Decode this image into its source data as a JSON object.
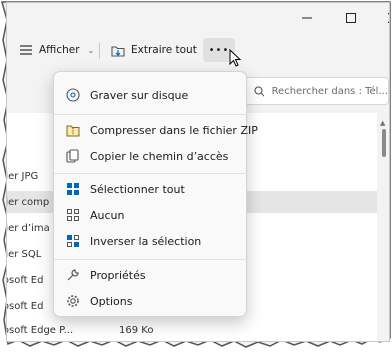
{
  "toolbar": {
    "view_label": "Afficher",
    "extract_label": "Extraire tout",
    "more_label": "•••"
  },
  "search": {
    "placeholder": "Rechercher dans : Tél..."
  },
  "menu": {
    "items": [
      {
        "label": "Graver sur disque",
        "icon": "disc-burn-icon"
      },
      {
        "label": "Compresser dans le fichier ZIP",
        "icon": "zip-folder-icon"
      },
      {
        "label": "Copier le chemin d’accès",
        "icon": "copy-path-icon"
      },
      {
        "label": "Sélectionner tout",
        "icon": "select-all-icon"
      },
      {
        "label": "Aucun",
        "icon": "select-none-icon"
      },
      {
        "label": "Inverser la sélection",
        "icon": "invert-selection-icon"
      },
      {
        "label": "Propriétés",
        "icon": "wrench-icon"
      },
      {
        "label": "Options",
        "icon": "gear-icon"
      }
    ]
  },
  "files": [
    {
      "name": "hier JPG",
      "size": ""
    },
    {
      "name": "hier comp",
      "size": ""
    },
    {
      "name": "hier d’ima",
      "size": ""
    },
    {
      "name": "hier SQL",
      "size": ""
    },
    {
      "name": "rosoft Ed",
      "size": ""
    },
    {
      "name": "rosoft Ed",
      "size": ""
    },
    {
      "name": "rosoft Edge P...",
      "size": "169 Ko"
    }
  ],
  "colors": {
    "accent": "#0067c0",
    "menu_bg": "#f9f9f9",
    "selected_row": "#e5e5e5"
  }
}
